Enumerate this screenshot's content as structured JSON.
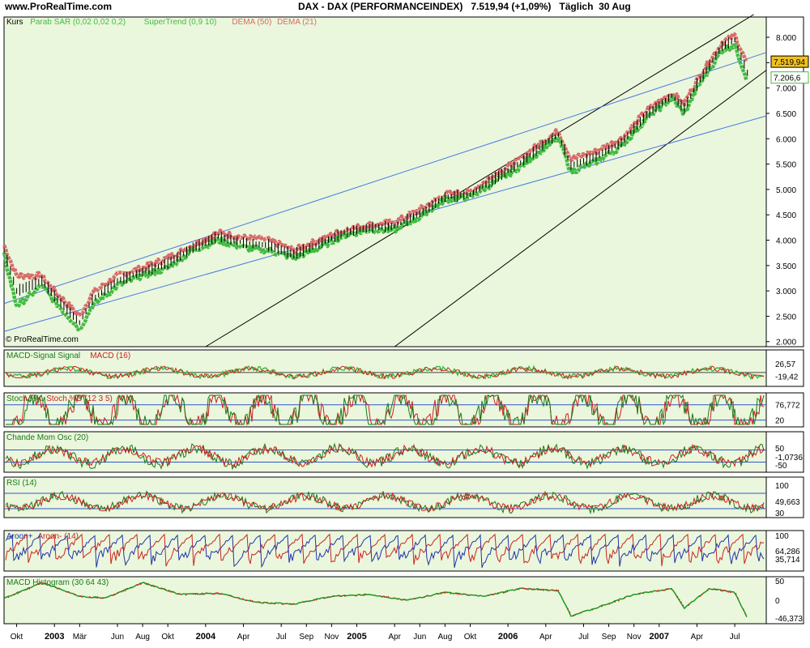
{
  "header": {
    "site": "www.ProRealTime.com",
    "title": "DAX - DAX (PERFORMANCEINDEX)   7.519,94 (+1,09%)   Täglich  30 Aug"
  },
  "watermark": "© ProRealTime.com",
  "colors": {
    "panel_bg": "#eaf7dc",
    "dema50": "#d96b6b",
    "dema21": "#44bb44",
    "channel_black": "#000000",
    "channel_blue": "#4a78e0",
    "last_price_tag": "#f0c020"
  },
  "x_axis": {
    "labels": [
      "Okt",
      "2003",
      "Mär",
      "Jun",
      "Aug",
      "Okt",
      "2004",
      "Apr",
      "Jul",
      "Sep",
      "Nov",
      "2005",
      "Apr",
      "Jun",
      "Aug",
      "Okt",
      "2006",
      "Apr",
      "Jul",
      "Sep",
      "Nov",
      "2007",
      "Apr",
      "Jul"
    ],
    "bold_year_labels": [
      "2003",
      "2004",
      "2005",
      "2006",
      "2007"
    ]
  },
  "chart_data": [
    {
      "type": "line",
      "panel": "price",
      "legend": [
        "Kurs",
        "Parab SAR (0,02 0,02 0,2)",
        "SuperTrend (0,9 10)",
        "DEMA (50)",
        "DEMA (21)"
      ],
      "y_ticks": [
        "8.000",
        "7.500",
        "7.000",
        "6.500",
        "6.000",
        "5.500",
        "5.000",
        "4.500",
        "4.000",
        "3.500",
        "3.000",
        "2.500",
        "2.000"
      ],
      "ylim": [
        1900,
        8400
      ],
      "last_value_label": "7.519,94",
      "second_value_label": "7.206,6",
      "series": [
        {
          "name": "DEMA (50)",
          "x": [
            "Sep 2002",
            "Okt 2002",
            "Dez 2002",
            "Jan 2003",
            "Mär 2003",
            "Apr 2003",
            "Jun 2003",
            "Aug 2003",
            "Okt 2003",
            "Dez 2003",
            "Feb 2004",
            "Apr 2004",
            "Jun 2004",
            "Aug 2004",
            "Okt 2004",
            "Dez 2004",
            "Feb 2005",
            "Apr 2005",
            "Jun 2005",
            "Aug 2005",
            "Okt 2005",
            "Dez 2005",
            "Feb 2006",
            "Apr 2006",
            "Mai 2006",
            "Jun 2006",
            "Aug 2006",
            "Okt 2006",
            "Dez 2006",
            "Feb 2007",
            "Mär 2007",
            "Apr 2007",
            "Jun 2007",
            "Jul 2007",
            "Aug 2007"
          ],
          "values": [
            3900,
            3300,
            3300,
            3000,
            2500,
            2950,
            3300,
            3450,
            3650,
            3900,
            4150,
            4050,
            4000,
            3800,
            4000,
            4200,
            4300,
            4350,
            4600,
            4900,
            4950,
            5300,
            5600,
            6000,
            6150,
            5600,
            5750,
            6000,
            6550,
            6900,
            6700,
            7150,
            7900,
            8050,
            7450
          ]
        },
        {
          "name": "DEMA (21)",
          "x": [
            "Sep 2002",
            "Okt 2002",
            "Dez 2002",
            "Jan 2003",
            "Mär 2003",
            "Apr 2003",
            "Jun 2003",
            "Aug 2003",
            "Okt 2003",
            "Dez 2003",
            "Feb 2004",
            "Apr 2004",
            "Jun 2004",
            "Aug 2004",
            "Okt 2004",
            "Dez 2004",
            "Feb 2005",
            "Apr 2005",
            "Jun 2005",
            "Aug 2005",
            "Okt 2005",
            "Dez 2005",
            "Feb 2006",
            "Apr 2006",
            "Mai 2006",
            "Jun 2006",
            "Aug 2006",
            "Okt 2006",
            "Dez 2006",
            "Feb 2007",
            "Mär 2007",
            "Apr 2007",
            "Jun 2007",
            "Jul 2007",
            "Aug 2007"
          ],
          "values": [
            3700,
            2700,
            3100,
            2800,
            2250,
            2700,
            3100,
            3300,
            3450,
            3800,
            4000,
            3850,
            3800,
            3650,
            3850,
            4100,
            4200,
            4200,
            4450,
            4800,
            4850,
            5150,
            5450,
            5850,
            6000,
            5350,
            5550,
            5850,
            6400,
            6800,
            6500,
            7000,
            7750,
            7850,
            7150
          ]
        }
      ]
    },
    {
      "type": "line",
      "panel": "macd",
      "legend": [
        "MACD-Signal Signal",
        "MACD (16)"
      ],
      "y_label_top": "26,57",
      "y_label_bottom": "-19,42"
    },
    {
      "type": "line",
      "panel": "stoch",
      "legend": [
        "Stoch %K",
        "Stoch %D (12 3 5)"
      ],
      "y_label_top": "76,772",
      "y_label_bottom": "20",
      "ylim": [
        0,
        100
      ]
    },
    {
      "type": "line",
      "panel": "chande",
      "legend": [
        "Chande Mom Osc (20)"
      ],
      "y_label_top": "50",
      "y_label_value": "-1,0736",
      "y_label_bottom": "-50"
    },
    {
      "type": "line",
      "panel": "rsi",
      "legend": [
        "RSI (14)"
      ],
      "y_label_top": "100",
      "y_label_value": "49,663",
      "y_label_bottom": "30",
      "ylim": [
        0,
        100
      ]
    },
    {
      "type": "line",
      "panel": "aroon",
      "legend": [
        "Aroon+",
        "Aroon- (14)"
      ],
      "y_label_top": "100",
      "y_label_value": "64,286",
      "y_label_bottom": "35,714",
      "ylim": [
        0,
        100
      ]
    },
    {
      "type": "line",
      "panel": "macd_hist",
      "legend": [
        "MACD Histogram (30 64 43)"
      ],
      "y_ticks": [
        "50",
        "0"
      ],
      "value_label": "-46,373",
      "ylim": [
        -60,
        60
      ],
      "series": [
        {
          "x": [
            "Sep 2002",
            "Dez 2002",
            "Mär 2003",
            "Mai 2003",
            "Aug 2003",
            "Nov 2003",
            "Feb 2004",
            "Mai 2004",
            "Aug 2004",
            "Nov 2004",
            "Feb 2005",
            "Mai 2005",
            "Aug 2005",
            "Nov 2005",
            "Feb 2006",
            "Mai 2006",
            "Jun 2006",
            "Aug 2006",
            "Nov 2006",
            "Feb 2007",
            "Mär 2007",
            "Mai 2007",
            "Jul 2007",
            "Aug 2007"
          ],
          "values": [
            5,
            45,
            10,
            5,
            45,
            15,
            18,
            -5,
            -10,
            10,
            15,
            0,
            20,
            10,
            30,
            25,
            -40,
            -20,
            15,
            30,
            -20,
            30,
            20,
            -46
          ]
        }
      ]
    }
  ]
}
